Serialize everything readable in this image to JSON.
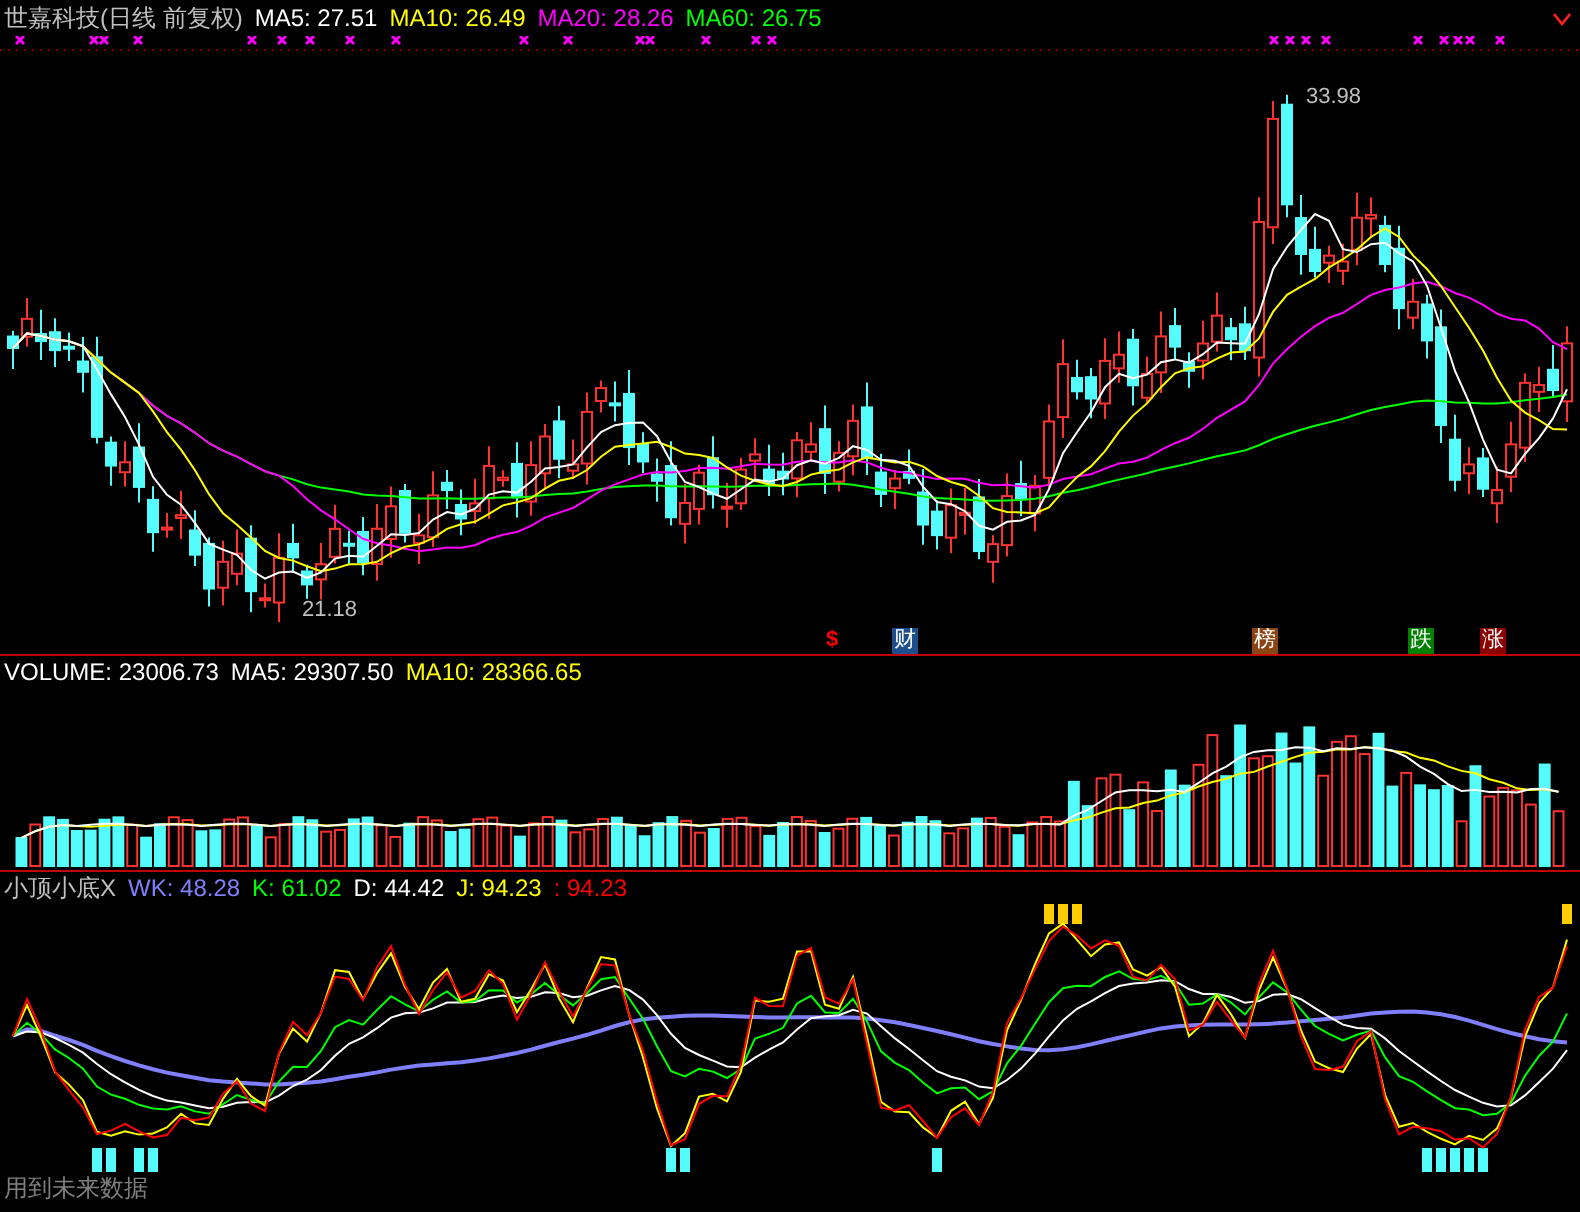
{
  "title": {
    "name": "世嘉科技(日线 前复权)",
    "averages": [
      {
        "label": "MA5: 27.51",
        "color": "#ffffff"
      },
      {
        "label": "MA10: 26.49",
        "color": "#ffff00"
      },
      {
        "label": "MA20: 28.26",
        "color": "#ff00ff"
      },
      {
        "label": "MA60: 26.75",
        "color": "#00ff00"
      }
    ]
  },
  "price_labels": {
    "high": "33.98",
    "low": "21.18"
  },
  "event_badges": [
    {
      "kind": "mark",
      "text": "$",
      "color": "#ff0000"
    },
    {
      "kind": "tag",
      "text": "财",
      "color": "#1f4e8c"
    },
    {
      "kind": "tag",
      "text": "榜",
      "color": "#8b4513"
    },
    {
      "kind": "tag",
      "text": "跌",
      "color": "#008000"
    },
    {
      "kind": "tag",
      "text": "涨",
      "color": "#8b0000"
    }
  ],
  "volume_header": [
    {
      "label": "VOLUME: 23006.73",
      "color": "#ffffff"
    },
    {
      "label": "MA5: 29307.50",
      "color": "#ffffff"
    },
    {
      "label": "MA10: 28366.65",
      "color": "#ffff00"
    }
  ],
  "indicator_header": {
    "name": "小顶小底X",
    "values": [
      {
        "label": "WK: 48.28",
        "color": "#8080ff"
      },
      {
        "label": "K: 61.02",
        "color": "#00ff00"
      },
      {
        "label": "D: 44.42",
        "color": "#ffffff"
      },
      {
        "label": "J: 94.23",
        "color": "#ffff00"
      },
      {
        "label": ": 94.23",
        "color": "#ff0000"
      }
    ]
  },
  "footnote": "用到未来数据"
}
